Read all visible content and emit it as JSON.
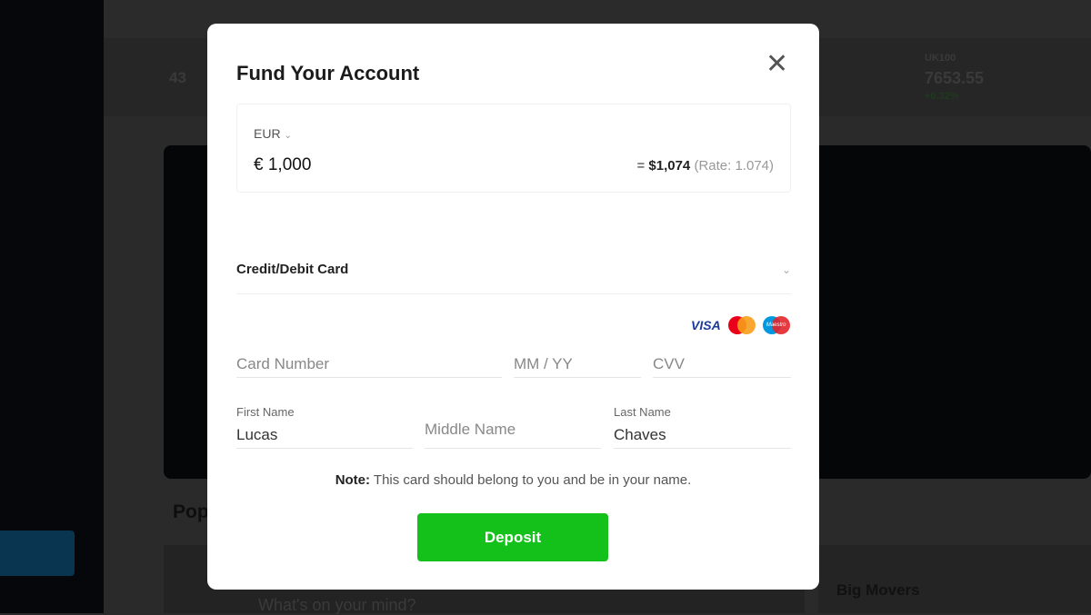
{
  "background": {
    "ticker": [
      {
        "value": "43"
      },
      {
        "symbol": "UK100",
        "value": "7653.55",
        "change": "+0.32%"
      }
    ],
    "section_title": "Pop",
    "feed_placeholder": "What's on your mind?",
    "big_movers": "Big Movers"
  },
  "modal": {
    "title": "Fund Your Account",
    "currency": "EUR",
    "amount": "€ 1,000",
    "converted_prefix": "= ",
    "converted": "$1,074",
    "rate": "(Rate: 1.074)",
    "payment_method": "Credit/Debit Card",
    "card_brands": [
      "VISA",
      "Mastercard",
      "Maestro"
    ],
    "card_number_placeholder": "Card Number",
    "expiry_placeholder": "MM / YY",
    "cvv_placeholder": "CVV",
    "first_name_label": "First Name",
    "first_name": "Lucas",
    "middle_name_placeholder": "Middle Name",
    "last_name_label": "Last Name",
    "last_name": "Chaves",
    "note_label": "Note:",
    "note_text": " This card should belong to you and be in your name.",
    "deposit_label": "Deposit"
  },
  "colors": {
    "accent": "#13c11a",
    "overlay": "#2a2a2a"
  }
}
